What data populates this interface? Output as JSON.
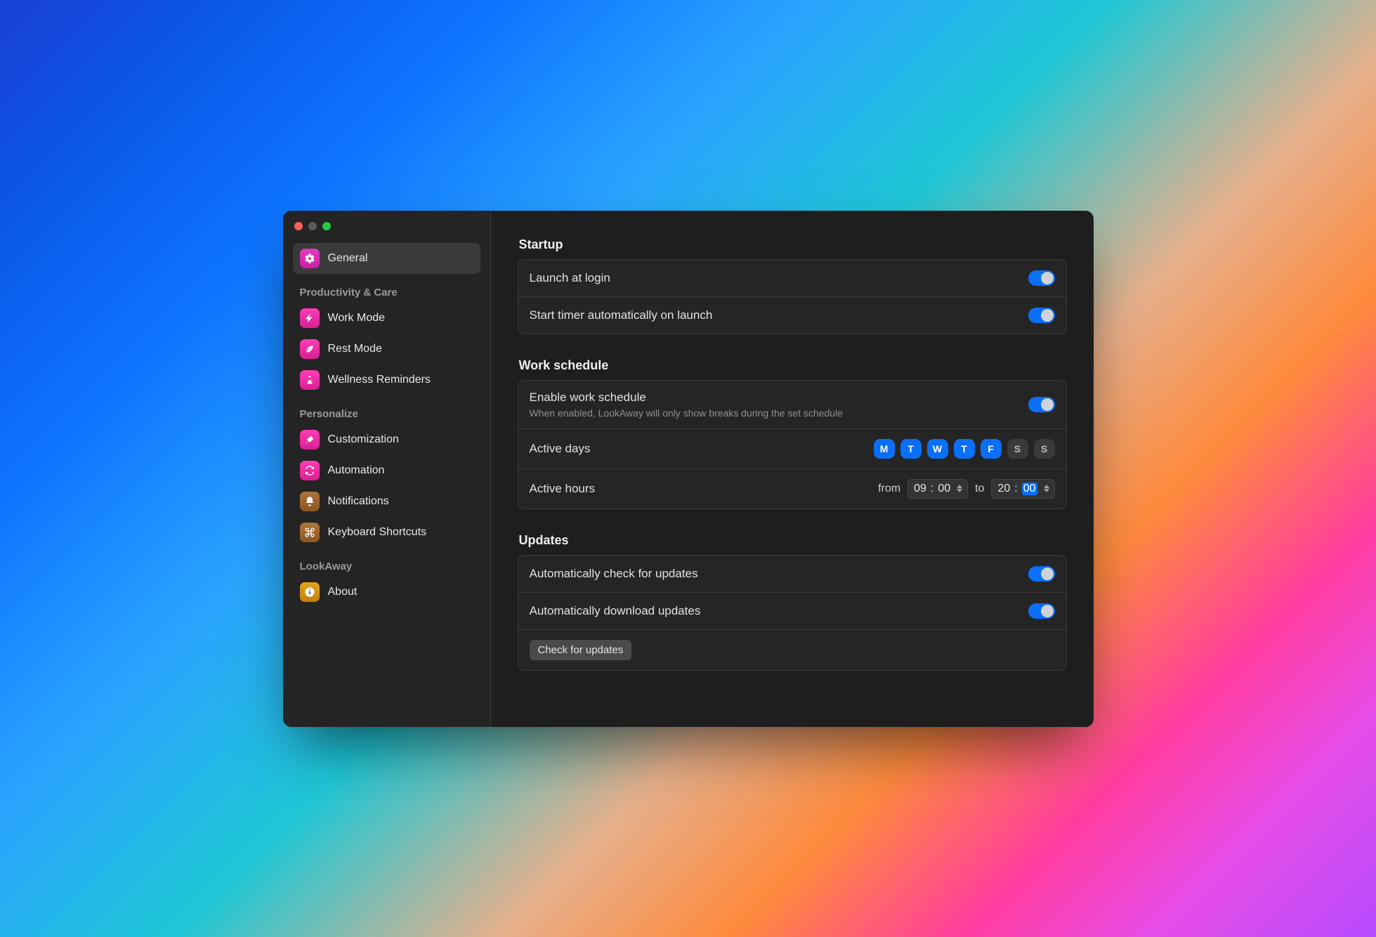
{
  "sidebar": {
    "items": [
      {
        "label": "General"
      }
    ],
    "groups": [
      {
        "title": "Productivity & Care",
        "items": [
          {
            "label": "Work Mode"
          },
          {
            "label": "Rest Mode"
          },
          {
            "label": "Wellness Reminders"
          }
        ]
      },
      {
        "title": "Personalize",
        "items": [
          {
            "label": "Customization"
          },
          {
            "label": "Automation"
          },
          {
            "label": "Notifications"
          },
          {
            "label": "Keyboard Shortcuts"
          }
        ]
      },
      {
        "title": "LookAway",
        "items": [
          {
            "label": "About"
          }
        ]
      }
    ]
  },
  "sections": {
    "startup": {
      "title": "Startup",
      "launch_at_login": {
        "label": "Launch at login",
        "value": true
      },
      "start_timer": {
        "label": "Start timer automatically on launch",
        "value": true
      }
    },
    "work_schedule": {
      "title": "Work schedule",
      "enable": {
        "label": "Enable work schedule",
        "description": "When enabled, LookAway will only show breaks during the set schedule",
        "value": true
      },
      "active_days": {
        "label": "Active days",
        "days": [
          {
            "abbr": "M",
            "on": true
          },
          {
            "abbr": "T",
            "on": true
          },
          {
            "abbr": "W",
            "on": true
          },
          {
            "abbr": "T",
            "on": true
          },
          {
            "abbr": "F",
            "on": true
          },
          {
            "abbr": "S",
            "on": false
          },
          {
            "abbr": "S",
            "on": false
          }
        ]
      },
      "active_hours": {
        "label": "Active hours",
        "from_word": "from",
        "to_word": "to",
        "from_h": "09",
        "from_m": "00",
        "to_h": "20",
        "to_m": "00"
      }
    },
    "updates": {
      "title": "Updates",
      "auto_check": {
        "label": "Automatically check for updates",
        "value": true
      },
      "auto_download": {
        "label": "Automatically download updates",
        "value": true
      },
      "button": "Check for updates"
    }
  }
}
